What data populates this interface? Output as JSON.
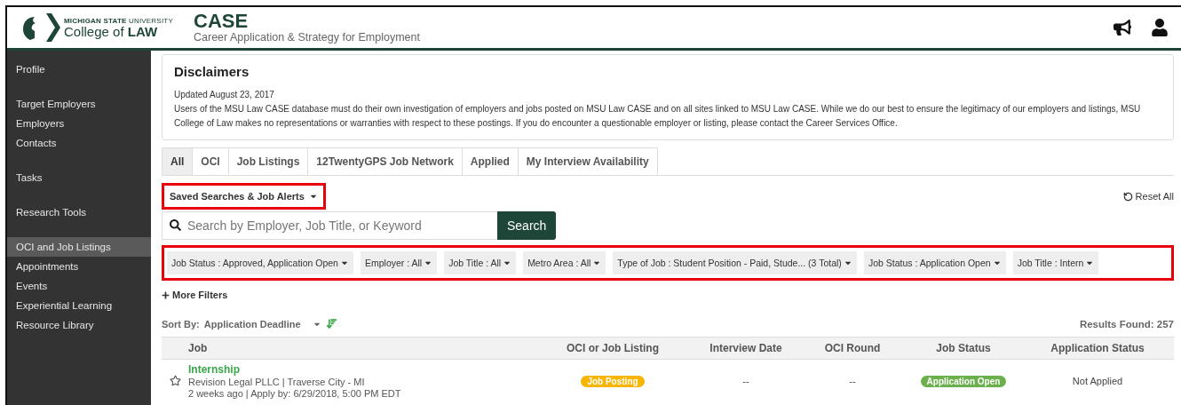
{
  "header": {
    "university": "**MICHIGAN STATE** UNIVERSITY",
    "college": "College of **LAW**",
    "title": "CASE",
    "subtitle": "Career Application & Strategy for Employment"
  },
  "sidebar": {
    "groups": [
      {
        "items": [
          {
            "label": "Profile",
            "selected": false
          }
        ]
      },
      {
        "items": [
          {
            "label": "Target Employers",
            "selected": false
          },
          {
            "label": "Employers",
            "selected": false
          },
          {
            "label": "Contacts",
            "selected": false
          }
        ]
      },
      {
        "items": [
          {
            "label": "Tasks",
            "selected": false
          }
        ]
      },
      {
        "items": [
          {
            "label": "Research Tools",
            "selected": false
          }
        ]
      },
      {
        "items": [
          {
            "label": "OCI and Job Listings",
            "selected": true
          },
          {
            "label": "Appointments",
            "selected": false
          },
          {
            "label": "Events",
            "selected": false
          },
          {
            "label": "Experiential Learning",
            "selected": false
          },
          {
            "label": "Resource Library",
            "selected": false
          }
        ]
      }
    ]
  },
  "disclaimer": {
    "title": "Disclaimers",
    "updated": "Updated August 23, 2017",
    "body": "Users of the MSU Law CASE database must do their own investigation of employers and jobs posted on MSU Law CASE and on all sites linked to MSU Law CASE. While we do our best to ensure the legitimacy of our employers and listings, MSU College of Law makes no representations or warranties with respect to these postings. If you do encounter a questionable employer or listing, please contact the Career Services Office."
  },
  "tabs": [
    {
      "label": "All",
      "selected": true
    },
    {
      "label": "OCI",
      "selected": false
    },
    {
      "label": "Job Listings",
      "selected": false
    },
    {
      "label": "12TwentyGPS Job Network",
      "selected": false
    },
    {
      "label": "Applied",
      "selected": false
    },
    {
      "label": "My Interview Availability",
      "selected": false
    }
  ],
  "saved_searches": {
    "label": "Saved Searches & Job Alerts",
    "highlighted": true
  },
  "reset": "Reset All",
  "search": {
    "placeholder": "Search by Employer, Job Title, or Keyword",
    "button": "Search"
  },
  "filters": {
    "highlighted": true,
    "items": [
      "Job Status : Approved, Application Open",
      "Employer : All",
      "Job Title : All",
      "Metro Area : All",
      "Type of Job : Student Position - Paid, Stude... (3 Total)",
      "Job Status : Application Open",
      "Job Title : Intern"
    ]
  },
  "more_filters": "More Filters",
  "sort": {
    "label": "Sort By:",
    "value": "Application Deadline"
  },
  "results": "Results Found: 257",
  "table": {
    "columns": [
      "Job",
      "OCI or Job Listing",
      "Interview Date",
      "OCI Round",
      "Job Status",
      "Application Status"
    ],
    "rows": [
      {
        "starred": false,
        "title": "Internship",
        "employer": "Revision Legal PLLC | Traverse City - MI",
        "meta": "2 weeks ago | Apply by: 6/29/2018, 5:00 PM EDT",
        "listing": {
          "text": "Job Posting",
          "color": "#f7b500"
        },
        "interview_date": "--",
        "oci_round": "--",
        "status": {
          "text": "Application Open",
          "color": "#6ab04c"
        },
        "application_status": "Not Applied"
      }
    ]
  }
}
